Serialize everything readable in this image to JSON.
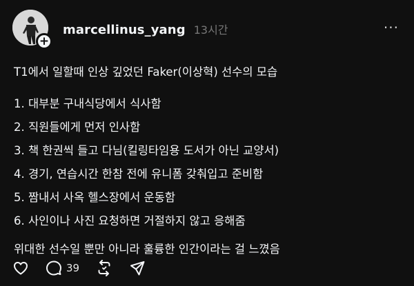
{
  "post": {
    "username": "marcellinus_yang",
    "timestamp": "13시간",
    "more_label": "···",
    "follow_label": "+",
    "headline": "T1에서 일할때 인상 깊었던 Faker(이상혁) 선수의 모습",
    "items": [
      "1. 대부분 구내식당에서 식사함",
      "2. 직원들에게 먼저 인사함",
      "3. 책 한권씩 들고 다님(킬링타임용 도서가 아닌 교양서)",
      "4. 경기, 연습시간 한참 전에 유니폼 갖춰입고 준비함",
      "5. 짬내서 사옥 헬스장에서 운동함",
      "6. 사인이나 사진 요청하면 거절하지 않고 응해줌"
    ],
    "closing": "위대한 선수일 뿐만 아니라 훌륭한 인간이라는 걸 느꼈음",
    "actions": {
      "like_icon": "heart-icon",
      "comment_icon": "comment-icon",
      "comment_count": "39",
      "repost_icon": "repost-icon",
      "share_icon": "send-icon"
    }
  }
}
